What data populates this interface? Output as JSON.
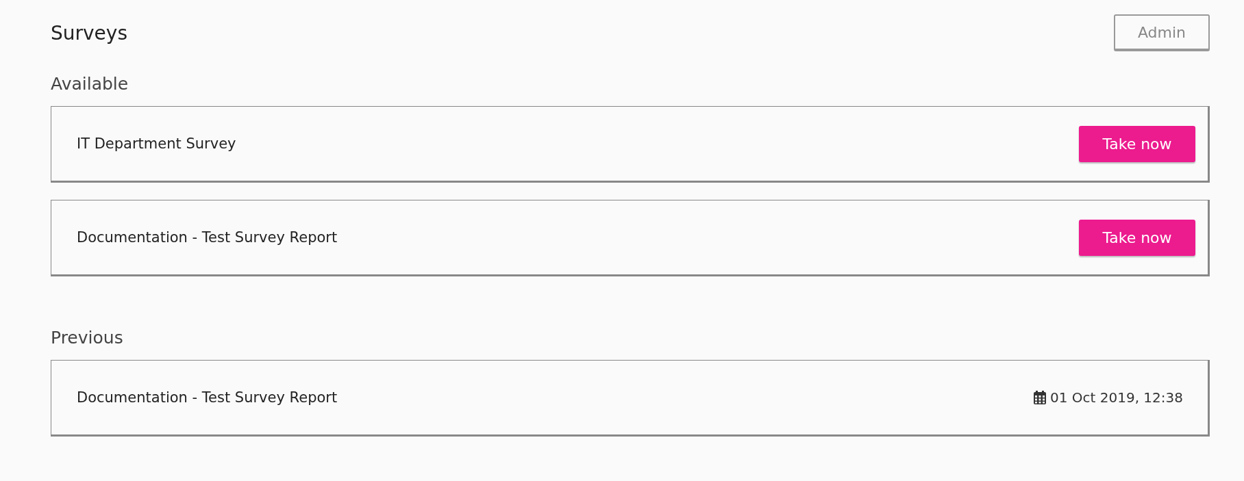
{
  "page": {
    "title": "Surveys",
    "admin_button": "Admin"
  },
  "sections": [
    {
      "heading": "Available",
      "items": [
        {
          "kind": "available",
          "name": "IT Department Survey",
          "action": "Take now"
        },
        {
          "kind": "available",
          "name": "Documentation - Test Survey Report",
          "action": "Take now"
        }
      ]
    },
    {
      "heading": "Previous",
      "items": [
        {
          "kind": "previous",
          "name": "Documentation - Test Survey Report",
          "date": "01 Oct 2019, 12:38"
        }
      ]
    }
  ]
}
